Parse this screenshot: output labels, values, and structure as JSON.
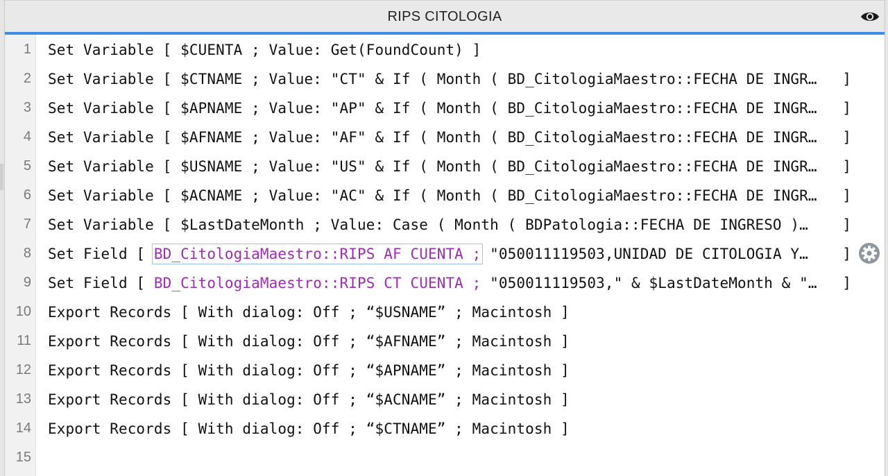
{
  "window": {
    "title": "RIPS CITOLOGIA"
  },
  "icons": {
    "view": "eye-icon",
    "step_options": "gear-icon"
  },
  "colors": {
    "accent": "#3a8ee6",
    "field_reference": "#9b2fae",
    "line_number": "#7a7a7a"
  },
  "script": {
    "lines": [
      {
        "num": "1",
        "pre": "Set Variable [ $CUENTA ; Value: Get(FoundCount) ]",
        "field": "",
        "post": "",
        "close": ""
      },
      {
        "num": "2",
        "pre": "Set Variable [ $CTNAME ; Value: \"CT\" & If ( Month ( BD_CitologiaMaestro::FECHA DE INGR…",
        "field": "",
        "post": "",
        "close": "]"
      },
      {
        "num": "3",
        "pre": "Set Variable [ $APNAME ; Value: \"AP\" & If ( Month ( BD_CitologiaMaestro::FECHA DE INGR…",
        "field": "",
        "post": "",
        "close": "]"
      },
      {
        "num": "4",
        "pre": "Set Variable [ $AFNAME ; Value: \"AF\" & If ( Month ( BD_CitologiaMaestro::FECHA DE INGR…",
        "field": "",
        "post": "",
        "close": "]"
      },
      {
        "num": "5",
        "pre": "Set Variable [ $USNAME ; Value: \"US\" & If ( Month ( BD_CitologiaMaestro::FECHA DE INGR…",
        "field": "",
        "post": "",
        "close": "]"
      },
      {
        "num": "6",
        "pre": "Set Variable [ $ACNAME ; Value: \"AC\" & If ( Month ( BD_CitologiaMaestro::FECHA DE INGR…",
        "field": "",
        "post": "",
        "close": "]"
      },
      {
        "num": "7",
        "pre": "Set Variable [ $LastDateMonth ; Value: Case ( Month ( BDPatologia::FECHA DE INGRESO )…",
        "field": "",
        "post": "",
        "close": "]"
      },
      {
        "num": "8",
        "pre": "Set Field [ ",
        "field": "BD_CitologiaMaestro::RIPS AF CUENTA ;",
        "post": " \"050011119503,UNIDAD DE CITOLOGIA Y…",
        "close": "]"
      },
      {
        "num": "9",
        "pre": "Set Field [ ",
        "field": "BD_CitologiaMaestro::RIPS CT CUENTA ;",
        "post": " \"050011119503,\" & $LastDateMonth & \"…",
        "close": "]"
      },
      {
        "num": "10",
        "pre": "Export Records [ With dialog: Off ; “$USNAME” ; Macintosh ]",
        "field": "",
        "post": "",
        "close": ""
      },
      {
        "num": "11",
        "pre": "Export Records [ With dialog: Off ; “$AFNAME” ; Macintosh ]",
        "field": "",
        "post": "",
        "close": ""
      },
      {
        "num": "12",
        "pre": "Export Records [ With dialog: Off ; “$APNAME” ; Macintosh ]",
        "field": "",
        "post": "",
        "close": ""
      },
      {
        "num": "13",
        "pre": "Export Records [ With dialog: Off ; “$ACNAME” ; Macintosh ]",
        "field": "",
        "post": "",
        "close": ""
      },
      {
        "num": "14",
        "pre": "Export Records [ With dialog: Off ; “$CTNAME” ; Macintosh ]",
        "field": "",
        "post": "",
        "close": ""
      },
      {
        "num": "15",
        "pre": "",
        "field": "",
        "post": "",
        "close": ""
      }
    ]
  }
}
